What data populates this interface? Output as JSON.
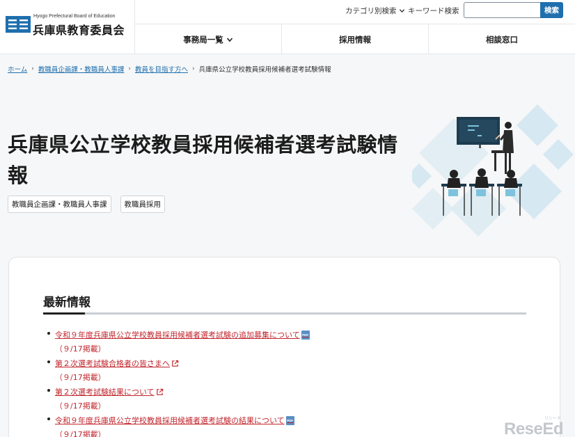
{
  "header": {
    "logo_en": "Hyogo Prefectural Board of Education",
    "logo_jp": "兵庫県教育委員会",
    "category_search": "カテゴリ別検索",
    "keyword_search": "キーワード検索",
    "search_placeholder": "",
    "search_button": "検索",
    "nav": [
      {
        "label": "事務局一覧"
      },
      {
        "label": "採用情報"
      },
      {
        "label": "相談窓口"
      }
    ]
  },
  "breadcrumb": {
    "items": [
      "ホーム",
      "教職員企画課・教職員人事課",
      "教員を目指す方へ"
    ],
    "current": "兵庫県公立学校教員採用候補者選考試験情報"
  },
  "page": {
    "title": "兵庫県公立学校教員採用候補者選考試験情報",
    "tags": [
      "教職員企画課・教職員人事課",
      "教職員採用"
    ]
  },
  "news": {
    "heading": "最新情報",
    "pdf_icon_text": "PDF",
    "items": [
      {
        "title": "令和９年度兵庫県公立学校教員採用候補者選考試験の追加募集について",
        "date": "（９/17掲載）",
        "icon": "pdf-icon"
      },
      {
        "title": "第２次選考試験合格者の皆さまへ",
        "date": "（９/17掲載）",
        "icon": "external-link-icon"
      },
      {
        "title": "第２次選考試験結果について",
        "date": "（９/17掲載）",
        "icon": "external-link-icon"
      },
      {
        "title": "令和９年度兵庫県公立学校教員採用候補者選考試験の結果について",
        "date": "（９/17掲載）",
        "icon": "pdf-icon"
      }
    ]
  },
  "watermark": {
    "text": "ReseEd",
    "sub": "リシード"
  },
  "colors": {
    "accent": "#1f6fae",
    "link_red": "#c0262d",
    "background": "#f6f7f8"
  }
}
